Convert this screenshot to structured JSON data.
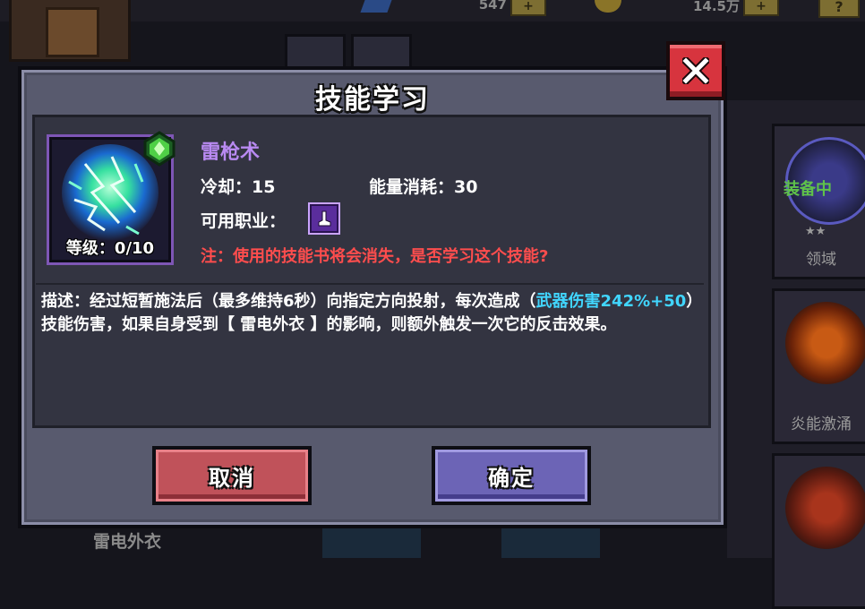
{
  "background": {
    "currency_1": "547",
    "currency_2": "14.5万",
    "plus_label": "+",
    "help_label": "?",
    "right_cards": [
      {
        "name": "领域",
        "status": "装备中",
        "stars": "★★"
      },
      {
        "name": "炎能激涌",
        "status": "",
        "stars": ""
      },
      {
        "name": "",
        "status": "",
        "stars": ""
      }
    ],
    "left_item_name": "雷电外衣"
  },
  "modal": {
    "title": "技能学习",
    "close_icon": "close-x-icon",
    "skill": {
      "name": "雷枪术",
      "level_label": "等级：0/10",
      "cooldown_label": "冷却：15",
      "energy_label": "能量消耗：30",
      "classes_label": "可用职业：",
      "class_icon": "boot-icon",
      "warning": "注：使用的技能书将会消失，是否学习这个技能?",
      "icon": "lightning-orb-icon",
      "rarity_icon": "green-gem-icon"
    },
    "description": {
      "part1": "描述：经过短暂施法后（最多维持6秒）向指定方向投射，每次造成（",
      "highlight": "武器伤害242%+50",
      "part2": "）技能伤害，如果自身受到【 雷电外衣 】的影响，则额外触发一次它的反击效果。"
    },
    "buttons": {
      "cancel": "取消",
      "confirm": "确定"
    }
  },
  "colors": {
    "skill_name": "#b98af2",
    "warning": "#ff4d4d",
    "highlight": "#41d6ff",
    "cancel_button": "#c0525a",
    "confirm_button": "#6c64b6",
    "close_button": "#d7343e"
  }
}
